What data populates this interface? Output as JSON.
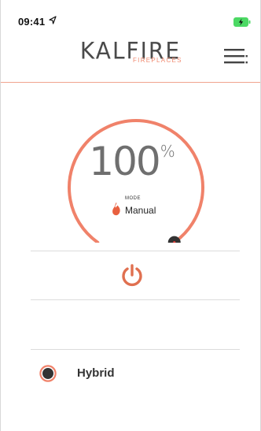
{
  "status_bar": {
    "time": "09:41",
    "location_icon": "location-arrow-icon",
    "battery_icon": "battery-charging-icon",
    "battery_color": "#4cd964"
  },
  "header": {
    "brand": "KALFIRE",
    "brand_sub": "FIREPLACES",
    "menu_icon": "hamburger-menu-icon",
    "accent_color": "#f0826a"
  },
  "dial": {
    "value": "100",
    "unit": "%",
    "level_fraction": 1.0,
    "mode_label": "MODE",
    "mode_value": "Manual",
    "mode_icon": "flame-icon",
    "arc_color": "#f0826a",
    "knob_color": "#333333"
  },
  "controls": {
    "power_icon": "power-icon",
    "power_color": "#e07050"
  },
  "hybrid": {
    "label": "Hybrid",
    "selected": true,
    "radio_color": "#f0826a"
  }
}
